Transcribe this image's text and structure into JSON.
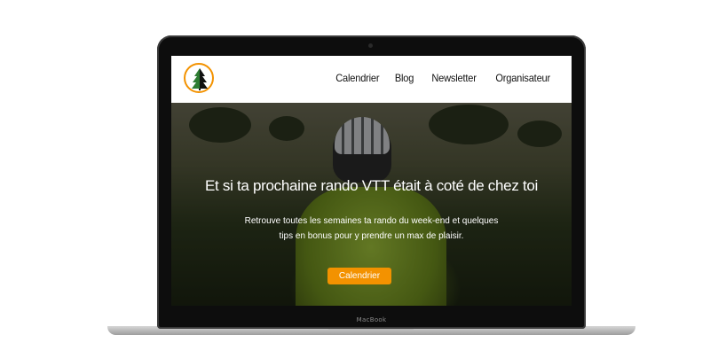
{
  "device": {
    "brand_label": "MacBook"
  },
  "site": {
    "logo_icon": "pine-tree-logo-icon",
    "accent_color": "#f39200",
    "nav": [
      {
        "label": "Calendrier"
      },
      {
        "label": "Blog"
      },
      {
        "label": "Newsletter"
      },
      {
        "label": "Organisateur"
      }
    ]
  },
  "hero": {
    "title": "Et si ta prochaine rando VTT était à coté de chez toi",
    "subtitle_line1": "Retrouve toutes les semaines ta rando du week-end et quelques",
    "subtitle_line2": "tips en bonus pour y prendre un max de plaisir.",
    "cta_label": "Calendrier"
  }
}
